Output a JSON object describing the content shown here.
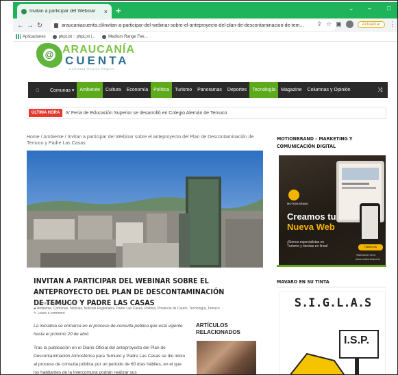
{
  "browser": {
    "tab_title": "Invitan a participar del Webinar",
    "tab_close": "×",
    "new_tab": "+",
    "url": "araucaniacuenta.cl/invitan-a-participar-del-webinar-sobre-el-anteproyecto-del-plan-de-descontaminacion-de-tem...",
    "update_button": "Actualizar",
    "bookmarks": [
      "Aplicaciones",
      "phpList :: phpList i...",
      "Medium Range Fee..."
    ]
  },
  "site": {
    "logo_line1": "ARAUCANÍA",
    "logo_line2": "CUENTA",
    "logo_tagline": "Comunas Región Región",
    "nav": [
      {
        "label": "Comunas ▾",
        "active": false
      },
      {
        "label": "Ambiente",
        "active": true
      },
      {
        "label": "Cultura",
        "active": false
      },
      {
        "label": "Economía",
        "active": false
      },
      {
        "label": "Política",
        "active": true
      },
      {
        "label": "Turismo",
        "active": false
      },
      {
        "label": "Panoramas",
        "active": false
      },
      {
        "label": "Deportes",
        "active": false
      },
      {
        "label": "Tecnología",
        "active": true
      },
      {
        "label": "Magazine",
        "active": false
      },
      {
        "label": "Columnas y Opinión",
        "active": false
      }
    ],
    "ticker_badge": "ÚLTIMA HORA",
    "ticker_text": "IV Feria de Educación Superior se desarrolló en Colegio Alemán de Temuco"
  },
  "article": {
    "breadcrumb": "Home / Ambiente / Invitan a participar del Webinar sobre el anteproyecto del Plan de Descontaminación de Temuco y Padre Las Casas",
    "title": "INVITAN A PARTICIPAR DEL WEBINAR SOBRE EL ANTEPROYECTO DEL PLAN DE DESCONTAMINACIÓN DE TEMUCO Y PADRE LAS CASAS",
    "author": "admin",
    "date": "Febrero 8, 2022",
    "categories": "Ambiente, Comunas, Noticias, Noticias Regionales, Padre Las Casas, Política, Provincia de Cautín, Tecnología, Temuco",
    "comment_link": "Leave a comment",
    "intro": "La iniciativa se enmarca en el proceso de consulta pública que está vigente hasta el próximo 20 de abril.",
    "paragraph": "Tras la publicación en el Diario Oficial del anteproyecto del Plan de Descontaminación Atmosférica para Temuco y Padre Las Casas se dio inicio al proceso de consulta pública por un periodo de 60 días hábiles, en el que los habitantes de la intercomuna podrán realizar sus",
    "related_heading": "ARTÍCULOS RELACIONADOS"
  },
  "sidebar": {
    "ad1_heading": "MOTIONBRAND – MARKETING Y COMUNICACIÓN DIGITAL",
    "ad1_brand": "MOTION BRAND",
    "ad1_line1": "Creamos tu",
    "ad1_line2": "Nueva Web",
    "ad1_sub": "¡Somos especialistas en Turismo y tiendas en línea!",
    "ad1_cta": "Hablemos",
    "ad1_phone": "+569 6403 7213",
    "ad1_site": "www.motionbrand.cl",
    "ad2_heading": "MAVARO EN SU TINTA",
    "ad2_title": "S.I.G.L.A.S",
    "ad2_sign": "I.S.P."
  },
  "colors": {
    "accent": "#5daa1d",
    "chrome": "#1fb45a",
    "badge": "#e33b30",
    "nav_bg": "#2a2a2a"
  }
}
